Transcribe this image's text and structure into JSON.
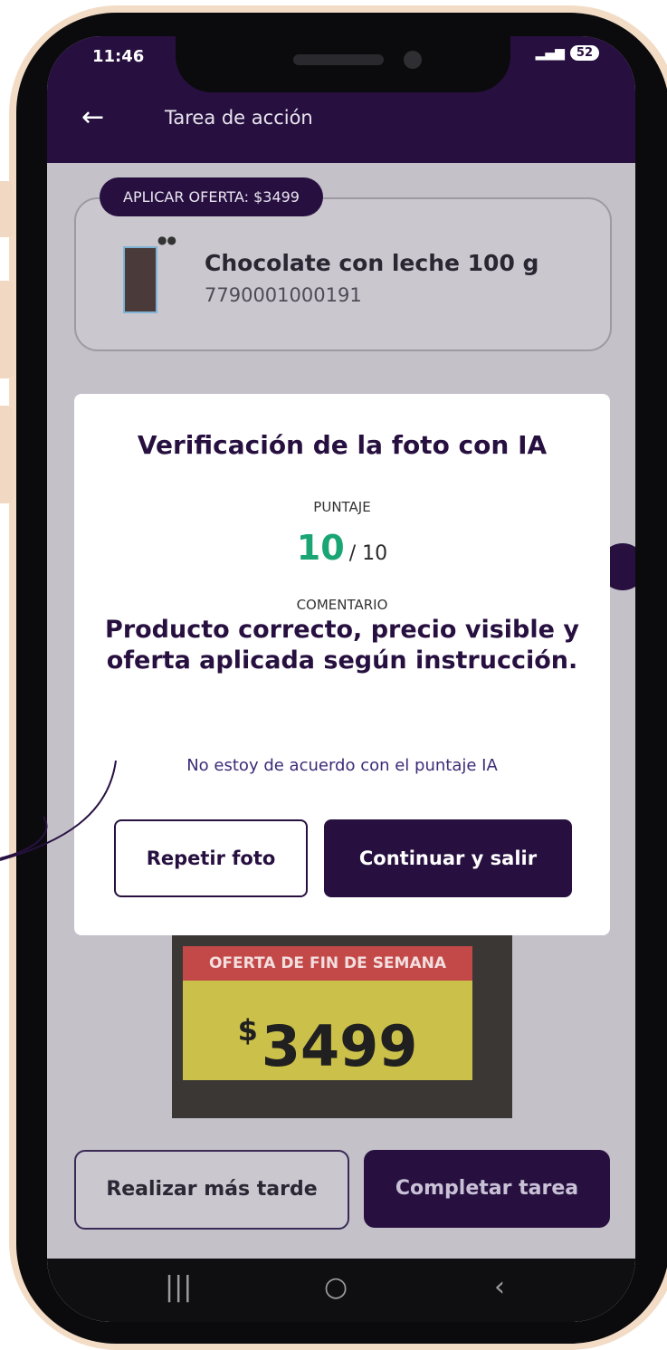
{
  "status_bar": {
    "time": "11:46",
    "battery": "52"
  },
  "app_bar": {
    "title": "Tarea de acción"
  },
  "offer_chip": "APLICAR OFERTA: $3499",
  "product": {
    "name": "Chocolate con leche 100 g",
    "code": "7790001000191"
  },
  "photo_sign": {
    "banner": "OFERTA DE FIN DE SEMANA",
    "currency": "$",
    "price": "3499"
  },
  "bottom_actions": {
    "later": "Realizar más tarde",
    "complete": "Completar tarea"
  },
  "modal": {
    "title": "Verificación de la foto con IA",
    "score_label": "PUNTAJE",
    "score": "10",
    "score_max": "/ 10",
    "comment_label": "COMENTARIO",
    "comment": "Producto correcto, precio visible y oferta aplicada según instrucción.",
    "disagree_link": "No estoy de acuerdo con el puntaje IA",
    "repeat_button": "Repetir foto",
    "continue_button": "Continuar y salir"
  },
  "colors": {
    "brand": "#271040",
    "score_green": "#1aa574",
    "frame": "#f3dcc5"
  }
}
